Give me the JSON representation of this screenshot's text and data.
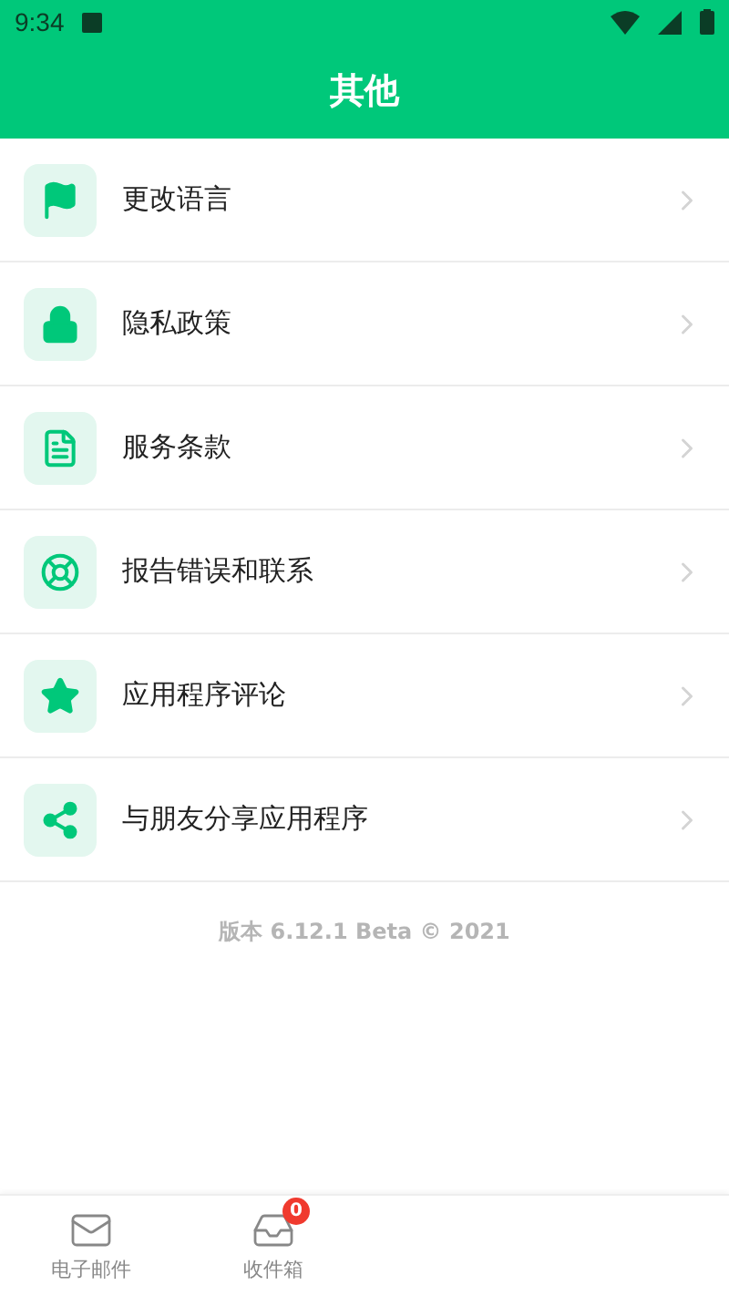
{
  "status_bar": {
    "time": "9:34"
  },
  "header": {
    "title": "其他"
  },
  "items": [
    {
      "label": "更改语言"
    },
    {
      "label": "隐私政策"
    },
    {
      "label": "服务条款"
    },
    {
      "label": "报告错误和联系"
    },
    {
      "label": "应用程序评论"
    },
    {
      "label": "与朋友分享应用程序"
    }
  ],
  "version": "版本 6.12.1 Beta © 2021",
  "bottom_nav": [
    {
      "label": "电子邮件",
      "selected": false
    },
    {
      "label": "收件箱",
      "selected": false,
      "badge": "0"
    }
  ]
}
